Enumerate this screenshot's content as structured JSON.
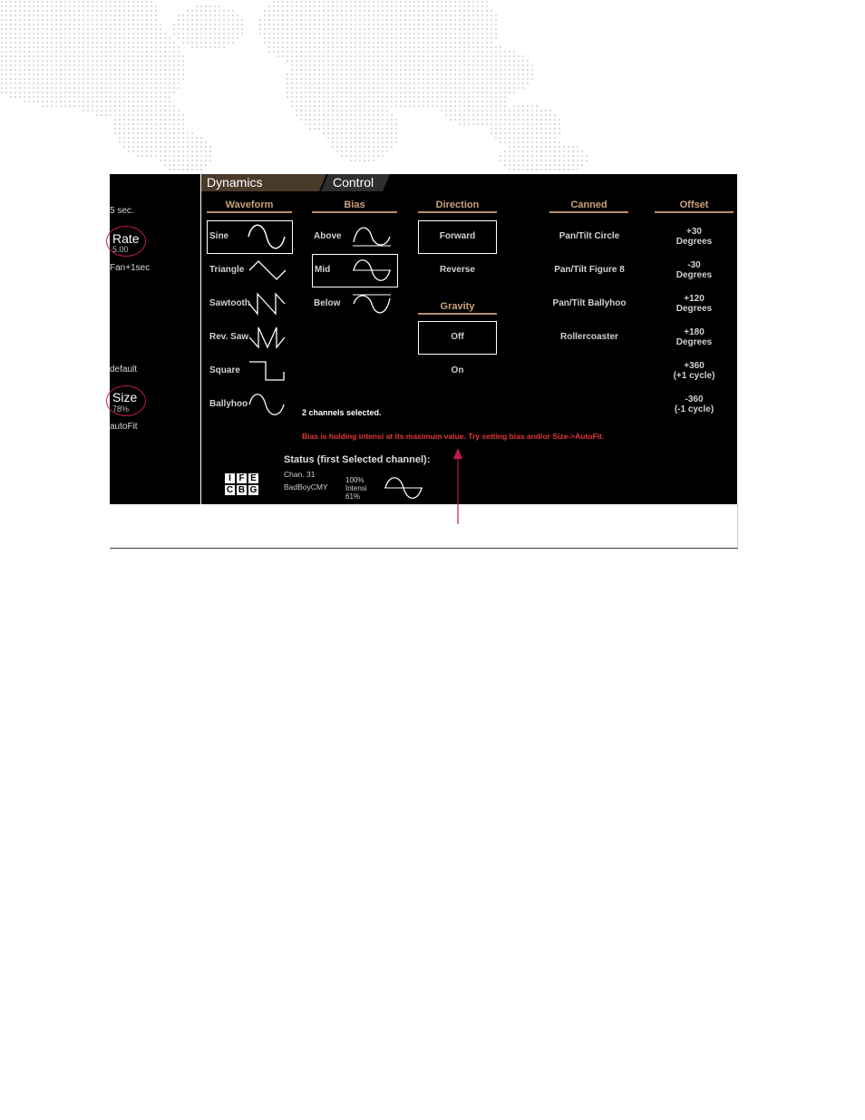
{
  "left_panel": {
    "rate_top": "5 sec.",
    "rate_label": "Rate",
    "rate_value": "5.00",
    "rate_bottom": "Fan+1sec",
    "size_top": "default",
    "size_label": "Size",
    "size_value": "78%",
    "size_bottom": "autoFit"
  },
  "tabs": {
    "active": "Dynamics",
    "inactive": "Control"
  },
  "headers": {
    "waveform": "Waveform",
    "bias": "Bias",
    "direction": "Direction",
    "gravity": "Gravity",
    "canned": "Canned",
    "offset": "Offset"
  },
  "waveforms": [
    {
      "label": "Sine",
      "icon": "sine-wave-icon",
      "selected": true
    },
    {
      "label": "Triangle",
      "icon": "triangle-wave-icon",
      "selected": false
    },
    {
      "label": "Sawtooth",
      "icon": "sawtooth-wave-icon",
      "selected": false
    },
    {
      "label": "Rev. Saw",
      "icon": "reverse-saw-wave-icon",
      "selected": false
    },
    {
      "label": "Square",
      "icon": "square-wave-icon",
      "selected": false
    },
    {
      "label": "Ballyhoo",
      "icon": "ballyhoo-wave-icon",
      "selected": false
    }
  ],
  "bias": [
    {
      "label": "Above",
      "icon": "bias-above-icon",
      "selected": false
    },
    {
      "label": "Mid",
      "icon": "bias-mid-icon",
      "selected": true
    },
    {
      "label": "Below",
      "icon": "bias-below-icon",
      "selected": false
    }
  ],
  "direction": [
    {
      "label": "Forward",
      "selected": true
    },
    {
      "label": "Reverse",
      "selected": false
    }
  ],
  "gravity": [
    {
      "label": "Off",
      "selected": true
    },
    {
      "label": "On",
      "selected": false
    }
  ],
  "canned": [
    {
      "label": "Pan/Tilt Circle"
    },
    {
      "label": "Pan/Tilt Figure 8"
    },
    {
      "label": "Pan/Tilt Ballyhoo"
    },
    {
      "label": "Rollercoaster"
    }
  ],
  "offsets": [
    {
      "line1": "+30",
      "line2": "Degrees"
    },
    {
      "line1": "-30",
      "line2": "Degrees"
    },
    {
      "line1": "+120",
      "line2": "Degrees"
    },
    {
      "line1": "+180",
      "line2": "Degrees"
    },
    {
      "line1": "+360",
      "line2": "(+1 cycle)"
    },
    {
      "line1": "-360",
      "line2": "(-1 cycle)"
    }
  ],
  "messages": {
    "selection": "2 channels selected.",
    "warning": "Bias is holding intensi at its maximum value.  Try setting bias and/or Size->AutoFit."
  },
  "status": {
    "title": "Status (first Selected channel):",
    "channel": "Chan. 31",
    "fixture": "BadBoyCMY",
    "value_top": "100%",
    "param": "Intensi",
    "value_bottom": "61%",
    "logo_letters": [
      "I",
      "F",
      "E",
      "C",
      "B",
      "G"
    ]
  },
  "colors": {
    "accent_header": "#c8a27a",
    "warning": "#e53935",
    "callout": "#c2185b",
    "tab_active": "#4a3a2a"
  }
}
